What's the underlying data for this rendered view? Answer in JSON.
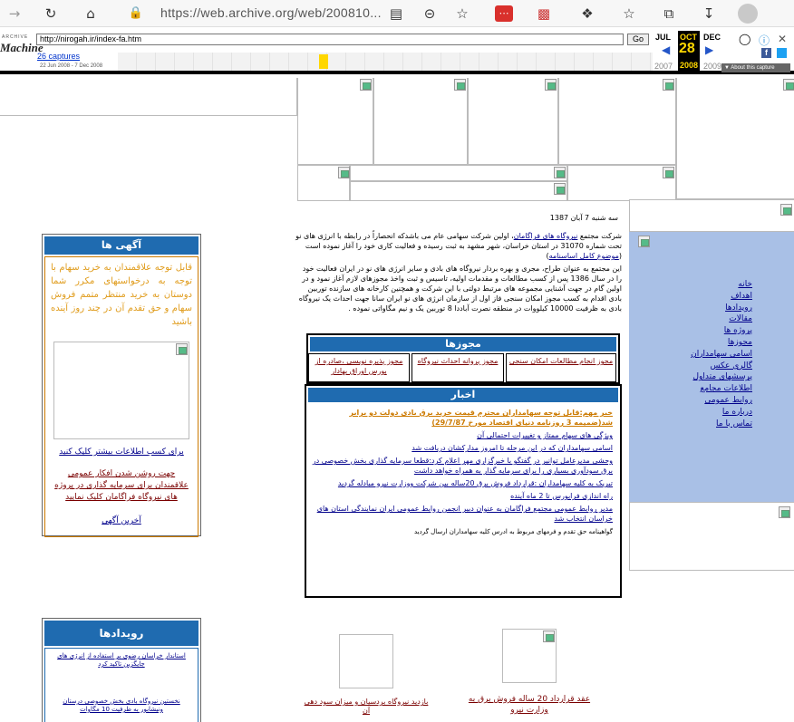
{
  "browser": {
    "url": "https://web.archive.org/web/200810...",
    "icons": [
      "back-icon",
      "refresh-icon",
      "home-icon",
      "lock-icon",
      "reader-icon",
      "zoom-out-icon",
      "add-favorite-icon",
      "extension-icon",
      "puzzle-icon",
      "favorites-icon",
      "collections-icon",
      "downloads-icon",
      "profile-icon"
    ]
  },
  "wayback": {
    "logo_top": "ARCHIVE",
    "logo_main": "Machine",
    "url_field": "http://nirogah.ir/index-fa.htm",
    "go_label": "Go",
    "captures_link": "26 captures",
    "captures_range": "22 Jun 2008 - 7 Dec 2008",
    "months": [
      "JUL",
      "OCT",
      "DEC"
    ],
    "day": "28",
    "years": [
      "2007",
      "2008",
      "2009"
    ],
    "about": "About this capture"
  },
  "date_line": "سه شنبه 7 آبان 1387",
  "intro": {
    "p1_before": "شرکت مجتمع ",
    "p1_link": "نیروگاه های فراگامان",
    "p1_after": "، اولین شرکت سهامی عام می باشدکه انحصاراً در رابطه با انرژی های نو تحت شماره 31070 در استان خراسان، شهر مشهد به ثبت رسیده و فعالیت کاری خود را آغاز نموده است (",
    "p1_link2": "موضوع کامل اساسنامه",
    "p1_end": ")",
    "p2": "این مجتمع به عنوان طراح، مجری و بهره بردار نیروگاه های بادی و سایر انرژی های نو در ایران فعالیت خود را در سال 1386 پس از کسب مطالعات و مقدمات اولیه، تاسیس و ثبت واخذ مجوزهای لازم آغاز نمود و در اولین گام در جهت آشنایی مجموعه های مرتبط دولتی با این شرکت و همچنین کارخانه های سازنده توربین بادی اقدام به کسب مجوز امکان سنجی فاز اول از سازمان انرژی های نو ایران سانا جهت احداث یک نیروگاه بادی به ظرفیت 10000 کیلووات در منطقه نصرت آباددا 8 توربین یک و نیم مگاواتی نموده ."
  },
  "permits": {
    "title": "مجوزها",
    "items": [
      "مجوز انجام مطالعات امکان سنجی",
      "مجوز پروانه احداث نیروگاه",
      "مجوز پذیره نویسی ،صادره از بورس اوراق بهادار"
    ]
  },
  "news": {
    "title": "اخبار",
    "highlight": "خبر مهم:قابل توجه سهامداران محترم قیمت خرید برق بادی دولت دو برابر شد(ضمیمه 3 روزنامه دنیای اقتصاد مورخ 29/7/87)",
    "items": [
      "ویژگی های سهام ممتاز و تغییرات احتمالی آن",
      "اسامی سهامداران که در این مرحله تا امروز مدارکشان دریافت شد",
      "وحشی مدیرعامل توانیر در گفتگو با خبرگزاری مهر اعلام کرد:قطعا سرمایه گذاری بخش خصوصی در برق سودآوری بسیاری را برای سرمایه گذار به همراه خواهد داشت",
      "تبریک به کلیه سهامداران :قرارداد فروش برق 20ساله بین شرکت ووزارت نیرو مبادله گردید",
      "راه اندازی فرابورس تا 2 ماه آینده",
      "مدیر روابط عمومی مجتمع فراگامان به عنوان دبیر انجمن روابط عمومی ایران نمایندگی استان های خراسان انتخاب شد"
    ],
    "footer": "گواهینامه حق تقدم و فرمهای مربوط به ادرس کلیه سهامداران ارسال گردید"
  },
  "ads": {
    "title": "آگهی ها",
    "text": "قابل توجه علاقمندان به خرید سهام با توجه به درخواستهای مکرر شما دوستان به خرید منتظر متمم فروش سهام و حق تقدم آن در چند روز آینده باشید",
    "link1": "برای کسب اطلاعات بیشتر کلیک کنید",
    "link2": "جهت روشن شدن افکار عمومی علاقمندان برای سرمایه گذاری در پروژه های نیروگاه فراگامان کلیک نمایید",
    "link3": "آخرین آگهی"
  },
  "events": {
    "title": "رویدادها",
    "item1": "استاندار خراسان رضوی بر استفاده از انرژی های جایگزین تاکید کرد",
    "item2": "نخستین نیروگاه بادی بخش خصوصی درستان ونیشابور به ظرفیت 10 مگاوات"
  },
  "menu": [
    "خانه",
    "اهداف",
    "رویدادها",
    "مقالات",
    "پروژه ها",
    "مجوزها",
    "اسامی سهامداران",
    "گالری عکس",
    "پرسشهای متداول",
    "اطلاعات مجامع",
    "روابط عمومی",
    "درباره ما",
    "تماس با ما"
  ],
  "captions": {
    "cap1": "عقد قرارداد 20 ساله فروش برق به وزارت نیرو",
    "cap2": "بازدید نیروگاه بردسیان و میزان سود دهی آن"
  },
  "colors": {
    "accent": "#1f6bb0",
    "menu_bg": "#a9c0e6",
    "link": "#00008b",
    "maroon": "#7a0000",
    "orange": "#cc7a00"
  }
}
